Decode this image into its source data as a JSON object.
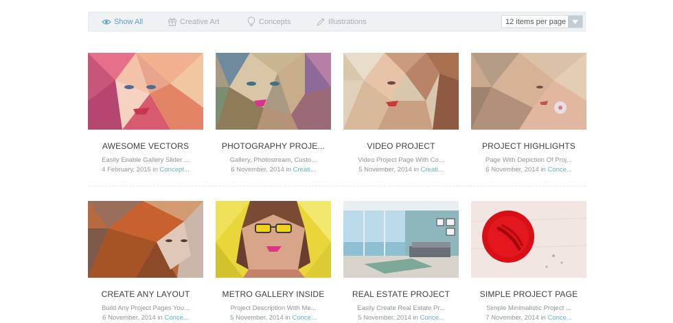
{
  "filters": {
    "show_all": "Show All",
    "creative_art": "Creative Art",
    "concepts": "Concepts",
    "illustrations": "Illustrations"
  },
  "per_page": {
    "selected": "12 items per page"
  },
  "meta_in": "in",
  "items": [
    {
      "title": "AWESOME VECTORS",
      "desc": "Easily Enable Gallery Slider ...",
      "date": "4 February, 2015",
      "category": "Concept..."
    },
    {
      "title": "PHOTOGRAPHY PROJE...",
      "desc": "Gallery, Photostream, Custo...",
      "date": "6 November, 2014",
      "category": "Creati..."
    },
    {
      "title": "VIDEO PROJECT",
      "desc": "Video Project Page With Co...",
      "date": "5 November, 2014",
      "category": "Creati..."
    },
    {
      "title": "PROJECT HIGHLIGHTS",
      "desc": "Page With Depiction Of Proj...",
      "date": "6 November, 2014",
      "category": "Conce..."
    },
    {
      "title": "CREATE ANY LAYOUT",
      "desc": "Build Any Project Pages You...",
      "date": "6 November, 2014",
      "category": "Conce..."
    },
    {
      "title": "METRO GALLERY INSIDE",
      "desc": "Project Description With Me...",
      "date": "5 November, 2014",
      "category": "Conce..."
    },
    {
      "title": "REAL ESTATE PROJECT",
      "desc": "Easily Create Real Estate Pr...",
      "date": "5 November, 2014",
      "category": "Conce..."
    },
    {
      "title": "SIMPLE PROJECT PAGE",
      "desc": "Simple Minimalistic Project ...",
      "date": "7 November, 2014",
      "category": "Conce..."
    }
  ],
  "colors": {
    "accent": "#5db3c9",
    "filter_active": "#5d9fc3",
    "filter_bar_bg": "#eef2f5"
  }
}
